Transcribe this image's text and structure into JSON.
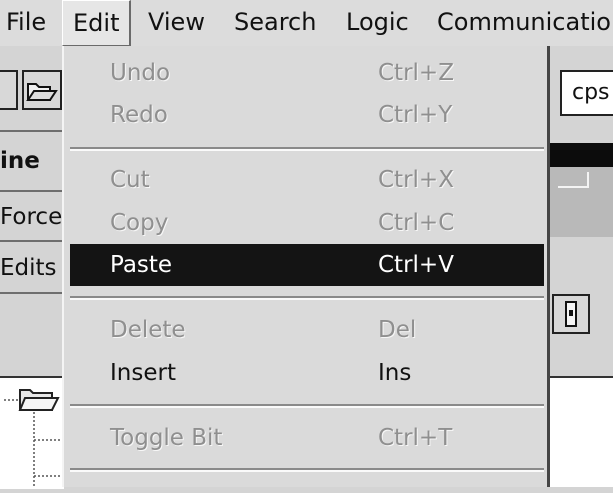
{
  "menubar": {
    "items": [
      "File",
      "Edit",
      "View",
      "Search",
      "Logic",
      "Communication"
    ],
    "open": "Edit"
  },
  "left_panel": {
    "labels": [
      "ine",
      "Force",
      "Edits"
    ]
  },
  "right_panel": {
    "field_value": "cps"
  },
  "edit_menu": {
    "items": [
      {
        "label": "Undo",
        "shortcut": "Ctrl+Z",
        "enabled": false
      },
      {
        "label": "Redo",
        "shortcut": "Ctrl+Y",
        "enabled": false
      },
      {
        "label": "Cut",
        "shortcut": "Ctrl+X",
        "enabled": false
      },
      {
        "label": "Copy",
        "shortcut": "Ctrl+C",
        "enabled": false
      },
      {
        "label": "Paste",
        "shortcut": "Ctrl+V",
        "enabled": true,
        "highlighted": true
      },
      {
        "label": "Delete",
        "shortcut": "Del",
        "enabled": false
      },
      {
        "label": "Insert",
        "shortcut": "Ins",
        "enabled": true
      },
      {
        "label": "Toggle Bit",
        "shortcut": "Ctrl+T",
        "enabled": false
      }
    ]
  },
  "colors": {
    "menu_bg": "#dadada",
    "highlight_bg": "#141414",
    "highlight_text": "#ffffff",
    "disabled_text": "#8f8f8f"
  }
}
